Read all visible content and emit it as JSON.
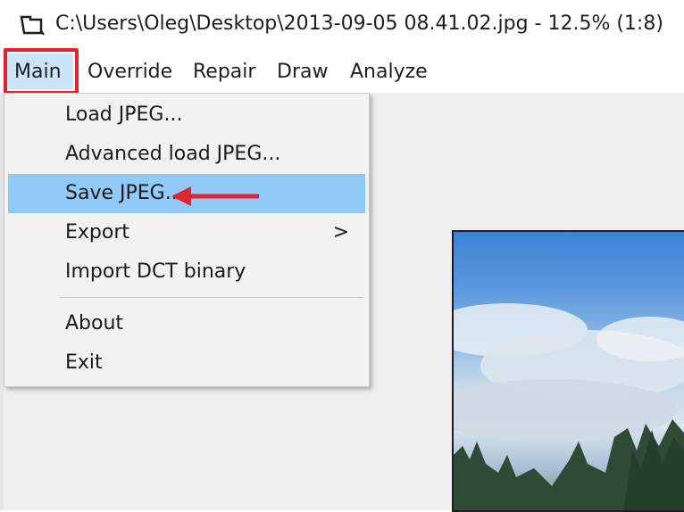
{
  "window": {
    "title": "C:\\Users\\Oleg\\Desktop\\2013-09-05 08.41.02.jpg - 12.5% (1:8)",
    "icon": "jpeg-app-icon"
  },
  "menubar": {
    "items": [
      {
        "label": "Main",
        "active": true
      },
      {
        "label": "Override"
      },
      {
        "label": "Repair"
      },
      {
        "label": "Draw"
      },
      {
        "label": "Analyze"
      }
    ]
  },
  "main_menu": {
    "items": [
      {
        "label": "Load JPEG..."
      },
      {
        "label": "Advanced load JPEG..."
      },
      {
        "label": "Save JPEG...",
        "highlighted": true
      },
      {
        "label": "Export",
        "submenu_indicator": ">"
      },
      {
        "label": "Import DCT binary"
      },
      {
        "label": "About"
      },
      {
        "label": "Exit"
      }
    ]
  },
  "annotations": {
    "highlight_color": "#e3232b",
    "arrow_target": "Save JPEG..."
  }
}
